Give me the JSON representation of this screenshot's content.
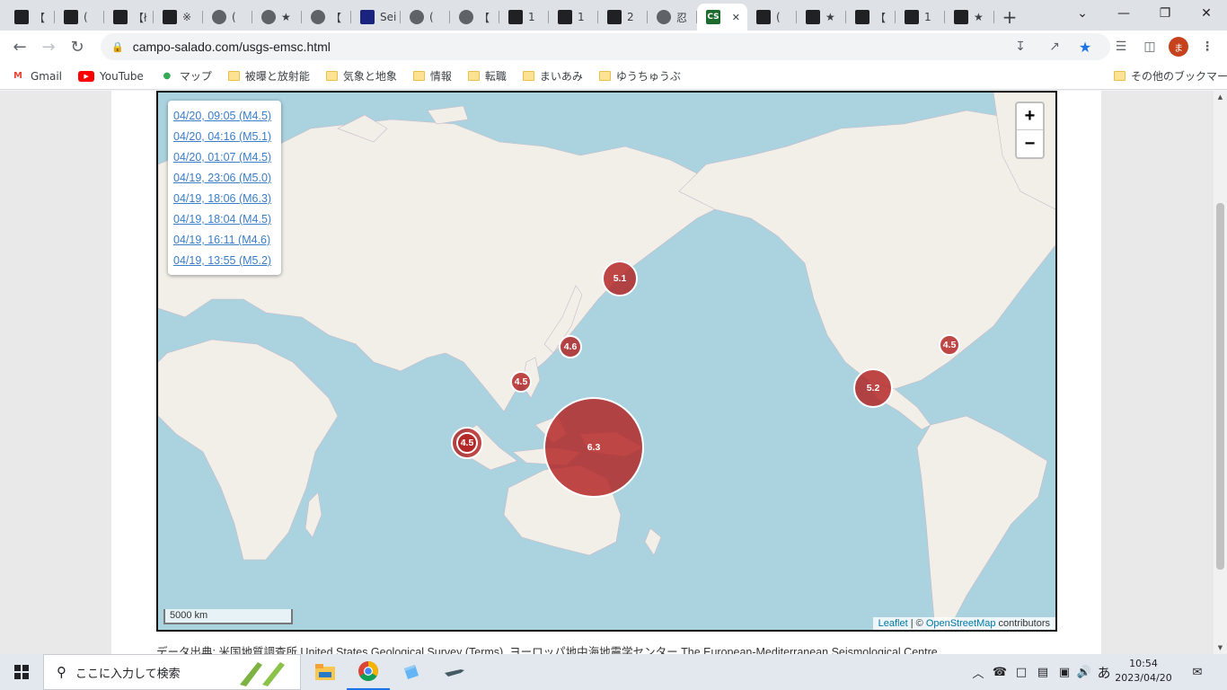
{
  "browser": {
    "tabs": [
      {
        "title": "【",
        "icon": "site-icon"
      },
      {
        "title": "(",
        "icon": "site-icon"
      },
      {
        "title": "【ł",
        "icon": "site-icon"
      },
      {
        "title": "※",
        "icon": "site-icon"
      },
      {
        "title": "(",
        "icon": "globe-icon"
      },
      {
        "title": "★",
        "icon": "globe-icon"
      },
      {
        "title": "【",
        "icon": "globe-icon"
      },
      {
        "title": "Sei",
        "icon": "image-icon"
      },
      {
        "title": "(",
        "icon": "globe-icon"
      },
      {
        "title": "【",
        "icon": "globe-icon"
      },
      {
        "title": "1",
        "icon": "site-icon"
      },
      {
        "title": "1",
        "icon": "site-icon"
      },
      {
        "title": "2",
        "icon": "site-icon"
      },
      {
        "title": "忍",
        "icon": "globe-icon"
      },
      {
        "title": "",
        "icon": "cs-icon",
        "active": true
      },
      {
        "title": "(",
        "icon": "site-icon"
      },
      {
        "title": "★",
        "icon": "site-icon"
      },
      {
        "title": "【",
        "icon": "site-icon"
      },
      {
        "title": "1",
        "icon": "site-icon"
      },
      {
        "title": "★",
        "icon": "site-icon"
      }
    ],
    "active_tab_favicon_text": "CS",
    "url": "campo-salado.com/usgs-emsc.html",
    "profile_initial": "ま",
    "bookmarks": [
      {
        "label": "Gmail",
        "icon": "gmail-icon"
      },
      {
        "label": "YouTube",
        "icon": "youtube-icon"
      },
      {
        "label": "マップ",
        "icon": "maps-icon"
      },
      {
        "label": "被曝と放射能",
        "icon": "folder-icon"
      },
      {
        "label": "気象と地象",
        "icon": "folder-icon"
      },
      {
        "label": "情報",
        "icon": "folder-icon"
      },
      {
        "label": "転職",
        "icon": "folder-icon"
      },
      {
        "label": "まいあみ",
        "icon": "folder-icon"
      },
      {
        "label": "ゆうちゅうぶ",
        "icon": "folder-icon"
      }
    ],
    "other_bookmarks": "その他のブックマーク"
  },
  "map": {
    "quake_list": [
      "04/20, 09:05 (M4.5)",
      "04/20, 04:16 (M5.1)",
      "04/20, 01:07 (M4.5)",
      "04/19, 23:06 (M5.0)",
      "04/19, 18:06 (M6.3)",
      "04/19, 18:04 (M4.5)",
      "04/19, 16:11 (M4.6)",
      "04/19, 13:55 (M5.2)"
    ],
    "markers": [
      {
        "label": "5.1",
        "magnitude": 5.1,
        "region": "kamchatka"
      },
      {
        "label": "4.6",
        "magnitude": 4.6,
        "region": "japan"
      },
      {
        "label": "4.5",
        "magnitude": 4.5,
        "region": "philippines"
      },
      {
        "label": "6.3",
        "magnitude": 6.3,
        "region": "new-guinea"
      },
      {
        "label": "5.0",
        "magnitude": 5.0,
        "region": "sumatra"
      },
      {
        "label": "4.5",
        "magnitude": 4.5,
        "region": "sumatra"
      },
      {
        "label": "5.2",
        "magnitude": 5.2,
        "region": "mexico"
      },
      {
        "label": "4.5",
        "magnitude": 4.5,
        "region": "caribbean"
      }
    ],
    "zoom_in": "+",
    "zoom_out": "−",
    "scale_label": "5000 km",
    "attribution": {
      "leaflet": "Leaflet",
      "separator": " | © ",
      "osm": "OpenStreetMap",
      "contributors": " contributors"
    },
    "colors": {
      "ocean": "#aad3df",
      "land": "#f2efe9",
      "marker": "#b22222"
    }
  },
  "source_text": "データ出典: 米国地質調査所 United States Geological Survey (Terms), ヨーロッパ地中海地震学センター The European-Mediterranean Seismological Centre",
  "taskbar": {
    "search_placeholder": "ここに入力して検索",
    "ime": "あ",
    "time": "10:54",
    "date": "2023/04/20"
  }
}
